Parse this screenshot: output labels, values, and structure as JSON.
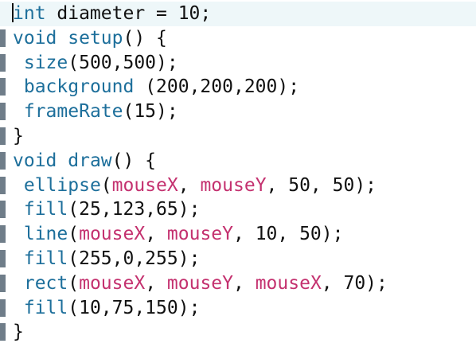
{
  "editor": {
    "current_line": 0,
    "lines": [
      {
        "tokens": [
          {
            "t": "int",
            "c": "kw"
          },
          {
            "t": " diameter = 10;",
            "c": "pl"
          }
        ]
      },
      {
        "tokens": [
          {
            "t": "void",
            "c": "kw"
          },
          {
            "t": " ",
            "c": "pl"
          },
          {
            "t": "setup",
            "c": "fn"
          },
          {
            "t": "() {",
            "c": "pl"
          }
        ]
      },
      {
        "tokens": [
          {
            "t": " ",
            "c": "pl"
          },
          {
            "t": "size",
            "c": "fn"
          },
          {
            "t": "(500,500);",
            "c": "pl"
          }
        ]
      },
      {
        "tokens": [
          {
            "t": " ",
            "c": "pl"
          },
          {
            "t": "background",
            "c": "fn"
          },
          {
            "t": " (200,200,200);",
            "c": "pl"
          }
        ]
      },
      {
        "tokens": [
          {
            "t": " ",
            "c": "pl"
          },
          {
            "t": "frameRate",
            "c": "fn"
          },
          {
            "t": "(15);",
            "c": "pl"
          }
        ]
      },
      {
        "tokens": [
          {
            "t": "}",
            "c": "pl"
          }
        ]
      },
      {
        "tokens": [
          {
            "t": "void",
            "c": "kw"
          },
          {
            "t": " ",
            "c": "pl"
          },
          {
            "t": "draw",
            "c": "fn"
          },
          {
            "t": "() {",
            "c": "pl"
          }
        ]
      },
      {
        "tokens": [
          {
            "t": " ",
            "c": "pl"
          },
          {
            "t": "ellipse",
            "c": "fn"
          },
          {
            "t": "(",
            "c": "pl"
          },
          {
            "t": "mouseX",
            "c": "var"
          },
          {
            "t": ", ",
            "c": "pl"
          },
          {
            "t": "mouseY",
            "c": "var"
          },
          {
            "t": ", 50, 50);",
            "c": "pl"
          }
        ]
      },
      {
        "tokens": [
          {
            "t": " ",
            "c": "pl"
          },
          {
            "t": "fill",
            "c": "fn"
          },
          {
            "t": "(25,123,65);",
            "c": "pl"
          }
        ]
      },
      {
        "tokens": [
          {
            "t": " ",
            "c": "pl"
          },
          {
            "t": "line",
            "c": "fn"
          },
          {
            "t": "(",
            "c": "pl"
          },
          {
            "t": "mouseX",
            "c": "var"
          },
          {
            "t": ", ",
            "c": "pl"
          },
          {
            "t": "mouseY",
            "c": "var"
          },
          {
            "t": ", 10, 50);",
            "c": "pl"
          }
        ]
      },
      {
        "tokens": [
          {
            "t": " ",
            "c": "pl"
          },
          {
            "t": "fill",
            "c": "fn"
          },
          {
            "t": "(255,0,255);",
            "c": "pl"
          }
        ]
      },
      {
        "tokens": [
          {
            "t": " ",
            "c": "pl"
          },
          {
            "t": "rect",
            "c": "fn"
          },
          {
            "t": "(",
            "c": "pl"
          },
          {
            "t": "mouseX",
            "c": "var"
          },
          {
            "t": ", ",
            "c": "pl"
          },
          {
            "t": "mouseY",
            "c": "var"
          },
          {
            "t": ", ",
            "c": "pl"
          },
          {
            "t": "mouseX",
            "c": "var"
          },
          {
            "t": ", 70);",
            "c": "pl"
          }
        ]
      },
      {
        "tokens": [
          {
            "t": " ",
            "c": "pl"
          },
          {
            "t": "fill",
            "c": "fn"
          },
          {
            "t": "(10,75,150);",
            "c": "pl"
          }
        ]
      },
      {
        "tokens": [
          {
            "t": "}",
            "c": "pl"
          }
        ]
      }
    ]
  },
  "colors": {
    "keyword": "#1d6f9b",
    "function": "#1d6f9b",
    "variable": "#c4316f",
    "plain": "#111111",
    "current_line_bg": "#eef7f9",
    "gutter_marker": "#6f7d89"
  }
}
